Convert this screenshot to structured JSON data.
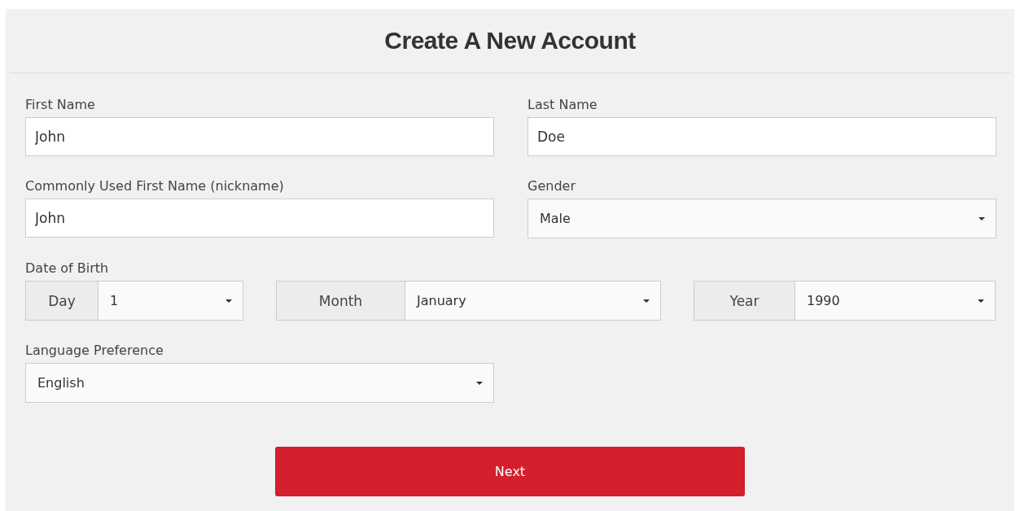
{
  "title": "Create A New Account",
  "fields": [
    {
      "kind": "text",
      "label": "First Name",
      "value": "John"
    },
    {
      "kind": "text",
      "label": "Last Name",
      "value": "Doe"
    },
    {
      "kind": "text",
      "label": "Commonly Used First Name (nickname)",
      "value": "John"
    },
    {
      "kind": "select",
      "label": "Gender",
      "value": "Male"
    },
    {
      "kind": "date",
      "label": "Date of Birth",
      "parts": [
        {
          "label": "Day",
          "value": "1"
        },
        {
          "label": "Month",
          "value": "January"
        },
        {
          "label": "Year",
          "value": "1990"
        }
      ]
    },
    {
      "kind": "select",
      "label": "Language Preference",
      "value": "English"
    }
  ],
  "button": "Next"
}
